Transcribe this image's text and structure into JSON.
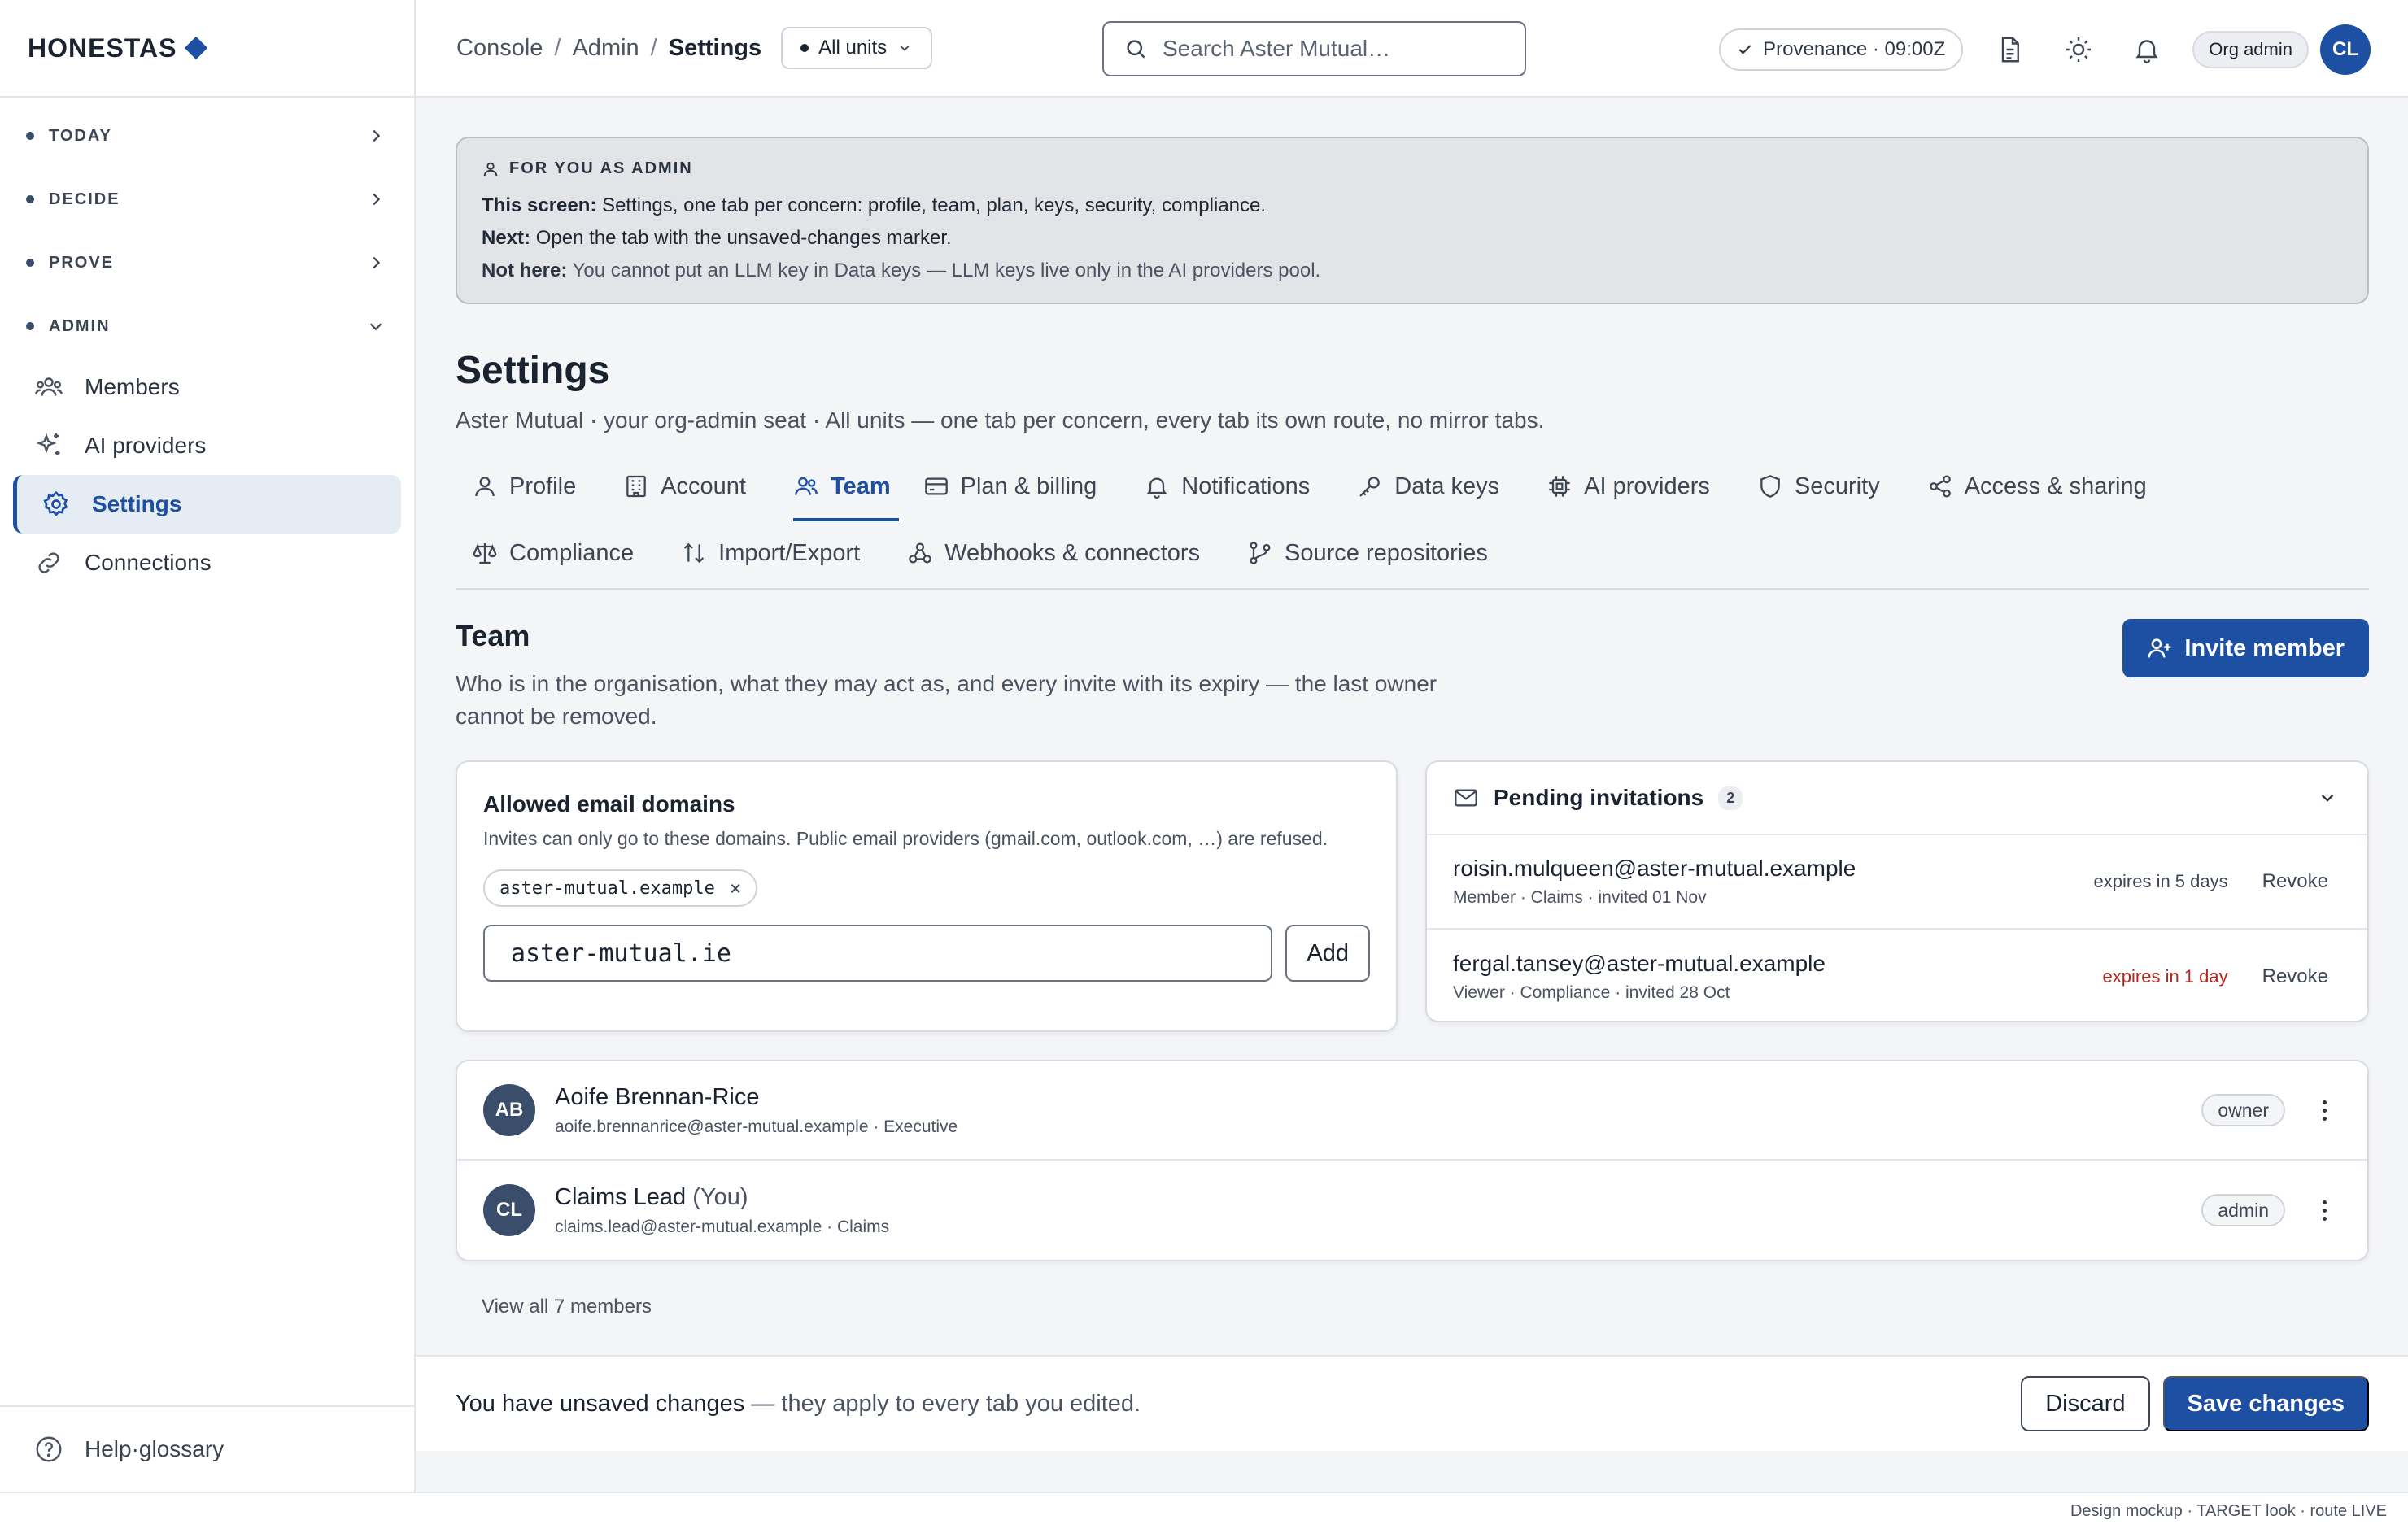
{
  "brand": {
    "name": "HONESTAS"
  },
  "sidebar": {
    "groups": [
      {
        "label": "TODAY"
      },
      {
        "label": "DECIDE"
      },
      {
        "label": "PROVE"
      },
      {
        "label": "ADMIN"
      }
    ],
    "items": [
      {
        "label": "Members",
        "icon": "members-icon"
      },
      {
        "label": "AI providers",
        "icon": "sparkle-icon"
      },
      {
        "label": "Settings",
        "icon": "gear-icon",
        "active": true
      },
      {
        "label": "Connections",
        "icon": "link-icon"
      }
    ],
    "footer": {
      "label": "Help·glossary",
      "icon": "help-icon"
    }
  },
  "topbar": {
    "breadcrumbs": [
      "Console",
      "Admin",
      "Settings"
    ],
    "breadcrumb_separator": "/",
    "unit_select": "All units",
    "search_placeholder": "Search Aster Mutual…",
    "provenance": "Provenance · 09:00Z",
    "role": "Org admin",
    "avatar_initials": "CL"
  },
  "admin_note": {
    "heading": "FOR YOU AS ADMIN",
    "screen_label": "This screen:",
    "screen_text": "Settings, one tab per concern: profile, team, plan, keys, security, compliance.",
    "next_label": "Next:",
    "next_text": "Open the tab with the unsaved-changes marker.",
    "not_here_label": "Not here:",
    "not_here_text": "You cannot put an LLM key in Data keys — LLM keys live only in the AI providers pool."
  },
  "page": {
    "title": "Settings",
    "subtitle": "Aster Mutual · your org-admin seat · All units — one tab per concern, every tab its own route, no mirror tabs."
  },
  "tabs": [
    {
      "label": "Profile",
      "icon": "user-icon"
    },
    {
      "label": "Account",
      "icon": "building-icon"
    },
    {
      "label": "Team",
      "icon": "team-icon",
      "active": true
    },
    {
      "label": "Plan & billing",
      "icon": "card-icon"
    },
    {
      "label": "Notifications",
      "icon": "bell-icon"
    },
    {
      "label": "Data keys",
      "icon": "key-icon"
    },
    {
      "label": "AI providers",
      "icon": "chip-icon"
    },
    {
      "label": "Security",
      "icon": "shield-icon"
    },
    {
      "label": "Access & sharing",
      "icon": "share-icon"
    },
    {
      "label": "Compliance",
      "icon": "scale-icon"
    },
    {
      "label": "Import/Export",
      "icon": "arrows-icon"
    },
    {
      "label": "Webhooks & connectors",
      "icon": "webhook-icon"
    },
    {
      "label": "Source repositories",
      "icon": "branch-icon"
    }
  ],
  "team": {
    "title": "Team",
    "description": "Who is in the organisation, what they may act as, and every invite with its expiry — the last owner cannot be removed.",
    "invite_button": "Invite member",
    "domains": {
      "title": "Allowed email domains",
      "subtitle": "Invites can only go to these domains. Public email providers (gmail.com, outlook.com, …) are refused.",
      "chips": [
        "aster-mutual.example"
      ],
      "input_value": "aster-mutual.ie",
      "add_label": "Add"
    },
    "pending": {
      "title": "Pending invitations",
      "count": "2",
      "rows": [
        {
          "email": "roisin.mulqueen@aster-mutual.example",
          "meta": "Member · Claims · invited 01 Nov",
          "expiry": "expires in 5 days",
          "urgent": false,
          "action": "Revoke"
        },
        {
          "email": "fergal.tansey@aster-mutual.example",
          "meta": "Viewer · Compliance · invited 28 Oct",
          "expiry": "expires in 1 day",
          "urgent": true,
          "action": "Revoke"
        }
      ]
    },
    "members": [
      {
        "initials": "AB",
        "name": "Aoife Brennan-Rice",
        "you": "",
        "meta": "aoife.brennanrice@aster-mutual.example · Executive",
        "role": "owner"
      },
      {
        "initials": "CL",
        "name": "Claims Lead",
        "you": "(You)",
        "meta": "claims.lead@aster-mutual.example · Claims",
        "role": "admin"
      }
    ],
    "view_all": "View all 7 members"
  },
  "savebar": {
    "text_strong": "You have unsaved changes",
    "text_rest": " — they apply to every tab you edited.",
    "discard": "Discard",
    "save": "Save changes"
  },
  "footer": {
    "note": "Design mockup · TARGET look · route LIVE"
  },
  "colors": {
    "accent": "#1d4fa3",
    "urgent": "#b3261e",
    "note_bg": "#e3e4e7"
  }
}
